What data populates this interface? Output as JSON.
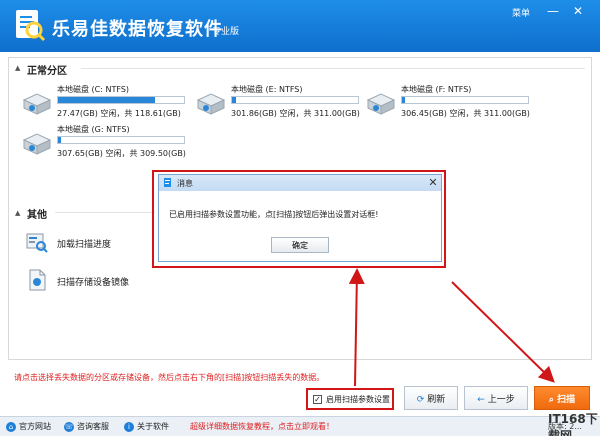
{
  "app": {
    "title": "乐易佳数据恢复软件",
    "edition": "专业版",
    "menu_label": "菜单"
  },
  "window_controls": {
    "minimize": "—",
    "close": "✕"
  },
  "partitions": {
    "heading": "正常分区",
    "disks": [
      {
        "label": "本地磁盘 (C: NTFS)",
        "size": "27.47(GB) 空闲，共 118.61(GB)",
        "used": 0.768
      },
      {
        "label": "本地磁盘 (E: NTFS)",
        "size": "301.86(GB) 空闲，共 311.00(GB)",
        "used": 0.03
      },
      {
        "label": "本地磁盘 (F: NTFS)",
        "size": "306.45(GB) 空闲，共 311.00(GB)",
        "used": 0.015
      },
      {
        "label": "本地磁盘 (G: NTFS)",
        "size": "307.65(GB) 空闲，共 309.50(GB)",
        "used": 0.006
      }
    ]
  },
  "others": {
    "heading": "其他",
    "items": [
      {
        "label": "加载扫描进度"
      },
      {
        "label": "扫描存储设备镜像"
      }
    ]
  },
  "dialog": {
    "title": "消息",
    "message": "已启用扫描参数设置功能，点[扫描]按钮后弹出设置对话框!",
    "ok_label": "确定"
  },
  "hint": "请点击选择丢失数据的分区或存储设备，然后点击右下角的[扫描]按钮扫描丢失的数据。",
  "actions": {
    "scan_params_label": "启用扫描参数设置",
    "scan_params_checked": true,
    "refresh_label": "刷新",
    "back_label": "上一步",
    "scan_label": "扫描"
  },
  "bottom": {
    "website": "官方网站",
    "support": "咨询客服",
    "about": "关于软件",
    "promo": "超级详细数据恢复教程，点击立即观看！",
    "version": "版本: 2..."
  },
  "watermark": "IT168下载网",
  "colors": {
    "accent": "#1a7fde",
    "scan": "#f07a1e",
    "annotation": "#d01616"
  }
}
